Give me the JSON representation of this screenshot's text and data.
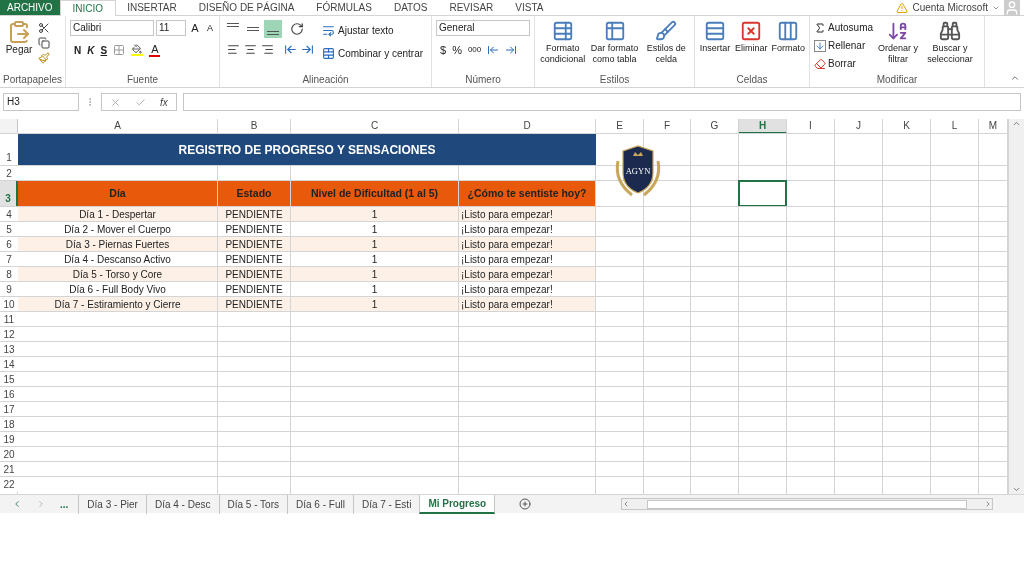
{
  "ribbon_tabs": [
    {
      "label": "ARCHIVO",
      "kind": "file",
      "selected": false
    },
    {
      "label": "INICIO",
      "kind": "tab",
      "selected": true
    },
    {
      "label": "INSERTAR",
      "kind": "tab",
      "selected": false
    },
    {
      "label": "DISEÑO DE PÁGINA",
      "kind": "tab",
      "selected": false
    },
    {
      "label": "FÓRMULAS",
      "kind": "tab",
      "selected": false
    },
    {
      "label": "DATOS",
      "kind": "tab",
      "selected": false
    },
    {
      "label": "REVISAR",
      "kind": "tab",
      "selected": false
    },
    {
      "label": "VISTA",
      "kind": "tab",
      "selected": false
    }
  ],
  "account": {
    "label": "Cuenta Microsoft"
  },
  "clipboard": {
    "paste": "Pegar",
    "label": "Portapapeles"
  },
  "font": {
    "name": "Calibri",
    "size": "11",
    "grow": "A",
    "shrink": "A",
    "bold": "N",
    "italic": "K",
    "underline": "S",
    "font_color": "A",
    "label": "Fuente"
  },
  "alignment": {
    "valign_buttons": [
      {
        "selected": false
      },
      {
        "selected": false
      },
      {
        "selected": true
      }
    ],
    "wrap": "Ajustar texto",
    "merge": "Combinar y centrar",
    "label": "Alineación"
  },
  "number": {
    "format": "General",
    "currency": "$",
    "percent": "%",
    "thousands": "000",
    "label": "Número"
  },
  "styles": {
    "buttons": [
      "Formato condicional",
      "Dar formato como tabla",
      "Estilos de celda"
    ],
    "label": "Estilos"
  },
  "cells": {
    "buttons": [
      "Insertar",
      "Eliminar",
      "Formato"
    ],
    "label": "Celdas"
  },
  "editing": {
    "autosum": "Autosuma",
    "fill": "Rellenar",
    "clear": "Borrar",
    "sort": "Ordenar y filtrar",
    "find": "Buscar y seleccionar",
    "label": "Modificar"
  },
  "formula_bar": {
    "name_box": "H3",
    "fx": "fx"
  },
  "columns": [
    {
      "label": "A",
      "selected": false
    },
    {
      "label": "B",
      "selected": false
    },
    {
      "label": "C",
      "selected": false
    },
    {
      "label": "D",
      "selected": false
    },
    {
      "label": "E",
      "selected": false
    },
    {
      "label": "F",
      "selected": false
    },
    {
      "label": "G",
      "selected": false
    },
    {
      "label": "H",
      "selected": true
    },
    {
      "label": "I",
      "selected": false
    },
    {
      "label": "J",
      "selected": false
    },
    {
      "label": "K",
      "selected": false
    },
    {
      "label": "L",
      "selected": false
    },
    {
      "label": "M",
      "selected": false
    }
  ],
  "rows": [
    {
      "number": "1",
      "selected": false
    },
    {
      "number": "2",
      "selected": false
    },
    {
      "number": "3",
      "selected": true
    },
    {
      "number": "4",
      "selected": false
    },
    {
      "number": "5",
      "selected": false
    },
    {
      "number": "6",
      "selected": false
    },
    {
      "number": "7",
      "selected": false
    },
    {
      "number": "8",
      "selected": false
    },
    {
      "number": "9",
      "selected": false
    },
    {
      "number": "10",
      "selected": false
    },
    {
      "number": "11",
      "selected": false
    },
    {
      "number": "12",
      "selected": false
    },
    {
      "number": "13",
      "selected": false
    },
    {
      "number": "14",
      "selected": false
    },
    {
      "number": "15",
      "selected": false
    },
    {
      "number": "16",
      "selected": false
    },
    {
      "number": "17",
      "selected": false
    },
    {
      "number": "18",
      "selected": false
    },
    {
      "number": "19",
      "selected": false
    },
    {
      "number": "20",
      "selected": false
    },
    {
      "number": "21",
      "selected": false
    },
    {
      "number": "22",
      "selected": false
    }
  ],
  "logo": {
    "text": "AGYN"
  },
  "sheet": {
    "title": "REGISTRO DE PROGRESO Y SENSACIONES",
    "header": [
      "Día",
      "Estado",
      "Nivel de Dificultad (1 al 5)",
      "¿Cómo te sentiste hoy?"
    ],
    "data": [
      [
        "Día 1 - Despertar",
        "PENDIENTE",
        "1",
        "¡Listo para empezar!"
      ],
      [
        "Día 2 - Mover el Cuerpo",
        "PENDIENTE",
        "1",
        "¡Listo para empezar!"
      ],
      [
        "Día 3 - Piernas Fuertes",
        "PENDIENTE",
        "1",
        "¡Listo para empezar!"
      ],
      [
        "Día 4 - Descanso Activo",
        "PENDIENTE",
        "1",
        "¡Listo para empezar!"
      ],
      [
        "Día 5 - Torso y Core",
        "PENDIENTE",
        "1",
        "¡Listo para empezar!"
      ],
      [
        "Día 6 - Full Body Vivo",
        "PENDIENTE",
        "1",
        "¡Listo para empezar!"
      ],
      [
        "Día 7 - Estiramiento y Cierre",
        "PENDIENTE",
        "1",
        "¡Listo para empezar!"
      ]
    ]
  },
  "sheet_tabs": {
    "more": "...",
    "tabs": [
      {
        "label": "Día 3 - Pier",
        "selected": false
      },
      {
        "label": "Día 4 - Desc",
        "selected": false
      },
      {
        "label": "Día 5 - Tors",
        "selected": false
      },
      {
        "label": "Día 6 - Full",
        "selected": false
      },
      {
        "label": "Día 7 - Esti",
        "selected": false
      },
      {
        "label": "Mi Progreso",
        "selected": true
      }
    ]
  }
}
